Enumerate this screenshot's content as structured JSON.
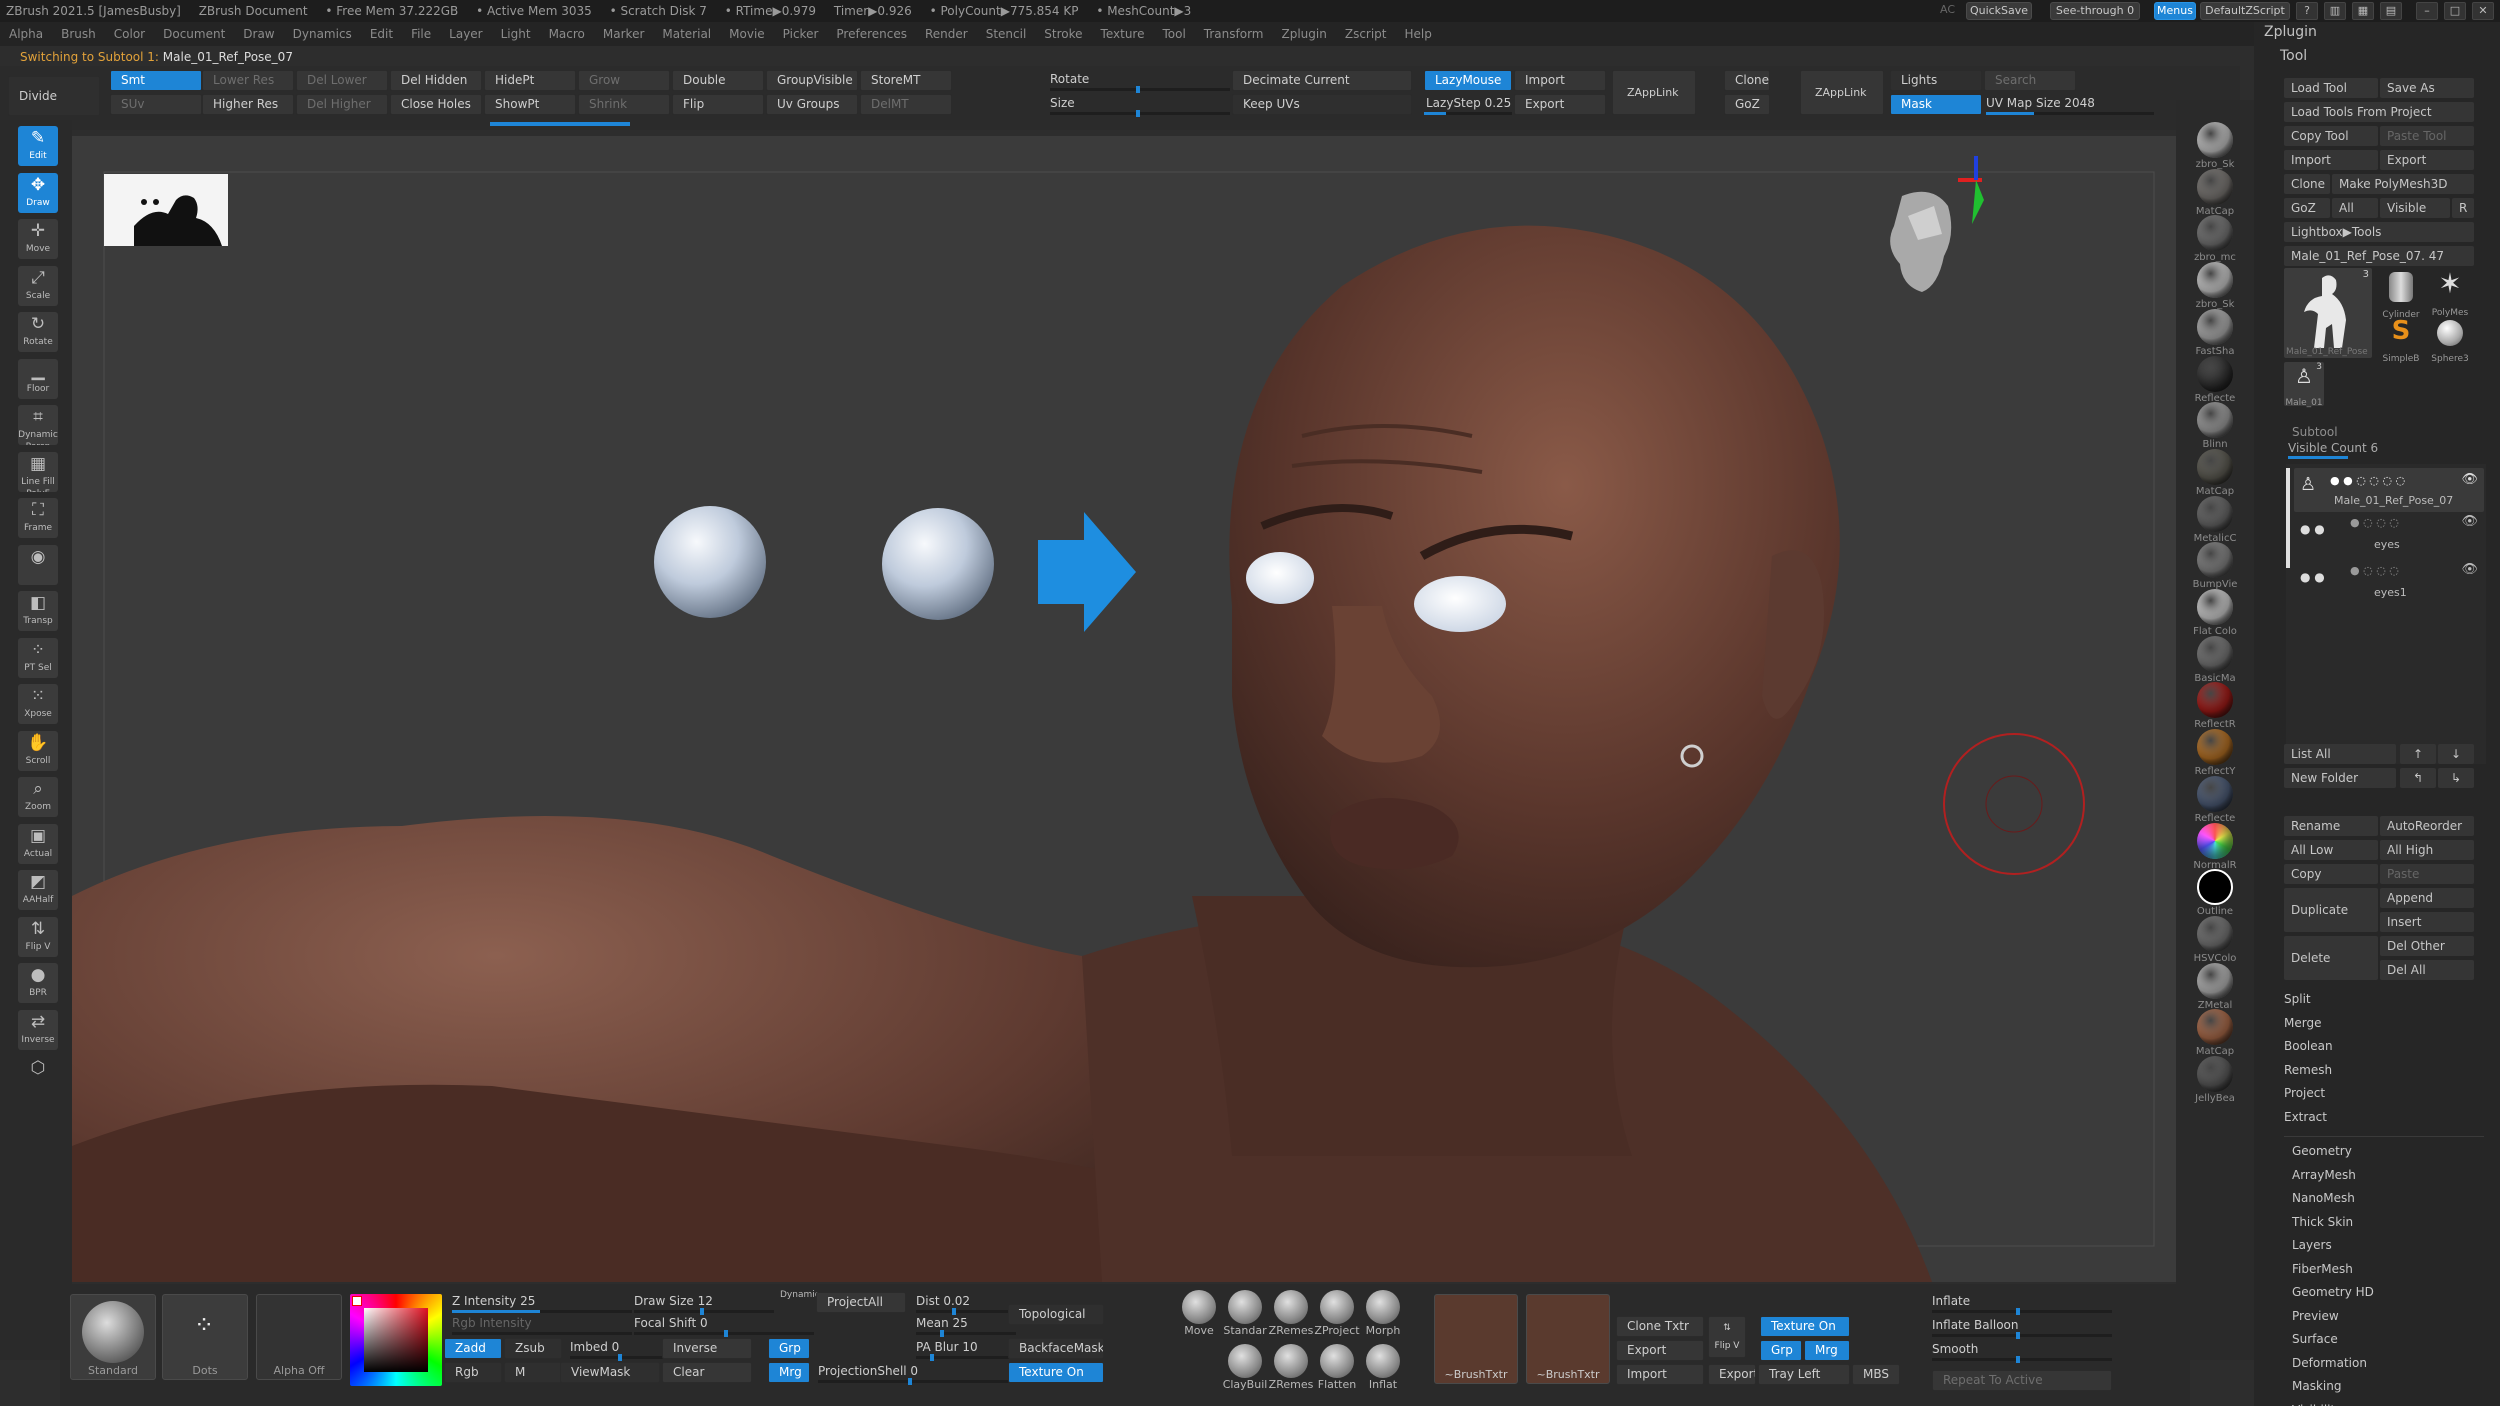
{
  "title_bar": {
    "app": "ZBrush 2021.5 [JamesBusby]",
    "document": "ZBrush Document",
    "free_mem": "• Free Mem 37.222GB",
    "active_mem": "• Active Mem 3035",
    "scratch_disk": "• Scratch Disk 7",
    "rtime": "• RTime▶0.979",
    "timer": "Timer▶0.926",
    "polycount": "• PolyCount▶775.854 KP",
    "meshcount": "• MeshCount▶3",
    "ac": "AC",
    "quicksave": "QuickSave",
    "see_through": "See-through  0",
    "menus": "Menus",
    "default_zscript": "DefaultZScript"
  },
  "menu_bar": [
    "Alpha",
    "Brush",
    "Color",
    "Document",
    "Draw",
    "Dynamics",
    "Edit",
    "File",
    "Layer",
    "Light",
    "Macro",
    "Marker",
    "Material",
    "Movie",
    "Picker",
    "Preferences",
    "Render",
    "Stencil",
    "Stroke",
    "Texture",
    "Tool",
    "Transform",
    "Zplugin",
    "Zscript",
    "Help"
  ],
  "notification": {
    "prefix": "Switching to Subtool 1:",
    "name": "Male_01_Ref_Pose_07"
  },
  "top_shelf": {
    "divide": "Divide",
    "smt": "Smt",
    "suv": "SUv",
    "lower_res": "Lower Res",
    "higher_res": "Higher Res",
    "del_lower": "Del Lower",
    "del_higher": "Del Higher",
    "del_hidden": "Del Hidden",
    "close_holes": "Close Holes",
    "hidept": "HidePt",
    "showpt": "ShowPt",
    "grow": "Grow",
    "shrink": "Shrink",
    "double": "Double",
    "flip": "Flip",
    "groupvisible": "GroupVisible",
    "uv_groups": "Uv Groups",
    "storemt": "StoreMT",
    "delmt": "DelMT",
    "rotate": "Rotate",
    "size": "Size",
    "decimate_current": "Decimate Current",
    "keep_uvs": "Keep UVs",
    "lazymouse": "LazyMouse",
    "lazystep": "LazyStep 0.25",
    "import": "Import",
    "export": "Export",
    "zapplink": "ZAppLink",
    "clone": "Clone",
    "goz": "GoZ",
    "zapplink2": "ZAppLink",
    "lights": "Lights",
    "search": "Search",
    "mask": "Mask",
    "uv_map_size": "UV Map Size 2048"
  },
  "left_shelf": [
    {
      "label": "Edit",
      "icon": "edit-icon"
    },
    {
      "label": "Draw",
      "icon": "draw-icon"
    },
    {
      "label": "Move",
      "icon": "move-icon"
    },
    {
      "label": "Scale",
      "icon": "scale-icon"
    },
    {
      "label": "Rotate",
      "icon": "rotate-icon"
    },
    {
      "label": "Floor",
      "icon": "floor-icon"
    },
    {
      "label": "Dynamic Persp",
      "icon": "perspective-icon"
    },
    {
      "label": "Line Fill PolyF",
      "icon": "polyframe-icon"
    },
    {
      "label": "Frame",
      "icon": "frame-icon"
    },
    {
      "label": "",
      "icon": "camera-icon"
    },
    {
      "label": "Transp",
      "icon": "transparency-icon"
    },
    {
      "label": "PT Sel",
      "icon": "point-select-icon"
    },
    {
      "label": "Xpose",
      "icon": "xpose-icon"
    },
    {
      "label": "Scroll",
      "icon": "scroll-icon"
    },
    {
      "label": "Zoom",
      "icon": "zoom-icon"
    },
    {
      "label": "Actual",
      "icon": "actual-icon"
    },
    {
      "label": "AAHalf",
      "icon": "aahalf-icon"
    },
    {
      "label": "Flip V",
      "icon": "flip-icon"
    },
    {
      "label": "BPR",
      "icon": "bpr-icon"
    },
    {
      "label": "Inverse",
      "icon": "inverse-icon"
    },
    {
      "label": "",
      "icon": "cube-icon"
    }
  ],
  "materials": [
    "zbro_Sk",
    "MatCap",
    "zbro_mc",
    "zbro_Sk",
    "FastSha",
    "Reflecte",
    "Blinn",
    "MatCap",
    "MetalicC",
    "BumpVie",
    "Flat Colo",
    "BasicMa",
    "ReflectR",
    "ReflectY",
    "Reflecte",
    "NormalR",
    "Outline",
    "HSVColo",
    "ZMetal",
    "MatCap",
    "JellyBea"
  ],
  "material_colors": [
    "#e9e9e9",
    "#8e8a86",
    "#8a8a8a",
    "#f0f0f0",
    "#cfcfcf",
    "#3a3a3a",
    "#bdbdbd",
    "#6c6a60",
    "#7a7a7a",
    "#9c9c9c",
    "#f4f4f4",
    "#8c8c8c",
    "#c0201c",
    "#d5842a",
    "#5a6c8c",
    "#6ab0e0",
    "#111111",
    "#8a8a8a",
    "#d8d8d8",
    "#c87c55",
    "#6a6a6a"
  ],
  "tool_panel": {
    "zplugin": "Zplugin",
    "tool": "Tool",
    "load_tool": "Load Tool",
    "save_as": "Save As",
    "load_tools_from_project": "Load Tools From Project",
    "copy_tool": "Copy Tool",
    "paste_tool": "Paste Tool",
    "import": "Import",
    "export": "Export",
    "clone": "Clone",
    "make_polymesh": "Make PolyMesh3D",
    "goz": "GoZ",
    "all": "All",
    "visible": "Visible",
    "r": "R",
    "lightbox_tools": "Lightbox▶Tools",
    "current_tool": "Male_01_Ref_Pose_07. 47",
    "thumb_count": "3",
    "thumb_tool_label": "Male_01_Ref_Pose",
    "cylinder_label": "Cylinder",
    "polymesh_label": "PolyMes",
    "simpleb_label": "SimpleB",
    "sphere_label": "Sphere3",
    "small_thumb_label": "Male_01",
    "small_thumb_count": "3",
    "subtool_header": "Subtool",
    "visible_count": "Visible Count 6",
    "subtools": [
      "Male_01_Ref_Pose_07",
      "eyes",
      "eyes1"
    ],
    "list_all": "List All",
    "new_folder": "New Folder",
    "rename": "Rename",
    "autoreorder": "AutoReorder",
    "all_low": "All Low",
    "all_high": "All High",
    "copy": "Copy",
    "paste": "Paste",
    "duplicate": "Duplicate",
    "append": "Append",
    "insert": "Insert",
    "delete": "Delete",
    "del_other": "Del Other",
    "del_all": "Del All",
    "actions": [
      "Split",
      "Merge",
      "Boolean",
      "Remesh",
      "Project",
      "Extract"
    ],
    "sections": [
      "Geometry",
      "ArrayMesh",
      "NanoMesh",
      "Thick Skin",
      "Layers",
      "FiberMesh",
      "Geometry HD",
      "Preview",
      "Surface",
      "Deformation",
      "Masking",
      "Visibility"
    ]
  },
  "bottom_shelf": {
    "standard": "Standard",
    "dots": "Dots",
    "alpha_off": "Alpha Off",
    "z_intensity": "Z Intensity 25",
    "rgb_intensity": "Rgb Intensity",
    "zadd": "Zadd",
    "zsub": "Zsub",
    "rgb": "Rgb",
    "m": "M",
    "draw_size": "Draw Size 12",
    "dynamic": "Dynamic",
    "focal_shift": "Focal Shift 0",
    "imbed": "Imbed 0",
    "viewmask": "ViewMask",
    "inverse": "Inverse",
    "clear": "Clear",
    "grp": "Grp",
    "mrg": "Mrg",
    "projectall": "ProjectAll",
    "projectionshell": "ProjectionShell 0",
    "dist": "Dist 0.02",
    "mean": "Mean 25",
    "pa_blur": "PA Blur 10",
    "topological": "Topological",
    "backfacemask": "BackfaceMask",
    "texture_on": "Texture On",
    "brushes_top": [
      "Move",
      "Standar",
      "ZRemes",
      "ZProject",
      "Morph"
    ],
    "brushes_bottom": [
      "ClayBuil",
      "ZRemes",
      "Flatten",
      "Inflat"
    ],
    "brushtxtr": "~BrushTxtr",
    "brushtxtr2": "~BrushTxtr",
    "clone_txtr": "Clone Txtr",
    "export": "Export",
    "import": "Import",
    "flip_v": "Flip V",
    "texture_on2": "Texture On",
    "grp2": "Grp",
    "mrg2": "Mrg",
    "export2": "Export",
    "tray_left": "Tray Left",
    "mbs": "MBS",
    "inflate": "Inflate",
    "inflate_balloon": "Inflate Balloon",
    "smooth": "Smooth",
    "repeat_to_active": "Repeat To Active"
  },
  "colors": {
    "accent": "#1e85d6",
    "warning": "#e2a23a"
  }
}
